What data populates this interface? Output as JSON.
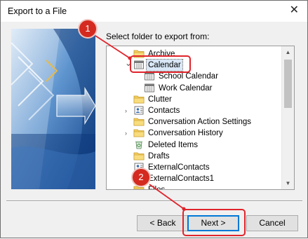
{
  "window": {
    "title": "Export to a File"
  },
  "icons": {
    "close": "close-icon"
  },
  "prompt": "Select folder to export from:",
  "tree": {
    "items": [
      {
        "label": "Archive",
        "icon": "folder-icon"
      },
      {
        "label": "Calendar",
        "icon": "calendar-icon",
        "selected": true,
        "expanded": true
      },
      {
        "label": "School Calendar",
        "icon": "calendar-icon"
      },
      {
        "label": "Work Calendar",
        "icon": "calendar-icon"
      },
      {
        "label": "Clutter",
        "icon": "folder-icon"
      },
      {
        "label": "Contacts",
        "icon": "contacts-icon",
        "expandable": true
      },
      {
        "label": "Conversation Action Settings",
        "icon": "folder-icon"
      },
      {
        "label": "Conversation History",
        "icon": "folder-icon",
        "expandable": true
      },
      {
        "label": "Deleted Items",
        "icon": "recycle-bin-icon"
      },
      {
        "label": "Drafts",
        "icon": "folder-icon"
      },
      {
        "label": "ExternalContacts",
        "icon": "contacts-icon"
      },
      {
        "label": "ExternalContacts1",
        "icon": "contacts-icon"
      },
      {
        "label": "Files",
        "icon": "folder-icon"
      }
    ]
  },
  "buttons": {
    "back": "< Back",
    "next": "Next >",
    "cancel": "Cancel"
  },
  "callouts": {
    "one": "1",
    "two": "2"
  },
  "colors": {
    "callout": "#e0242b",
    "accent": "#0078d7"
  }
}
